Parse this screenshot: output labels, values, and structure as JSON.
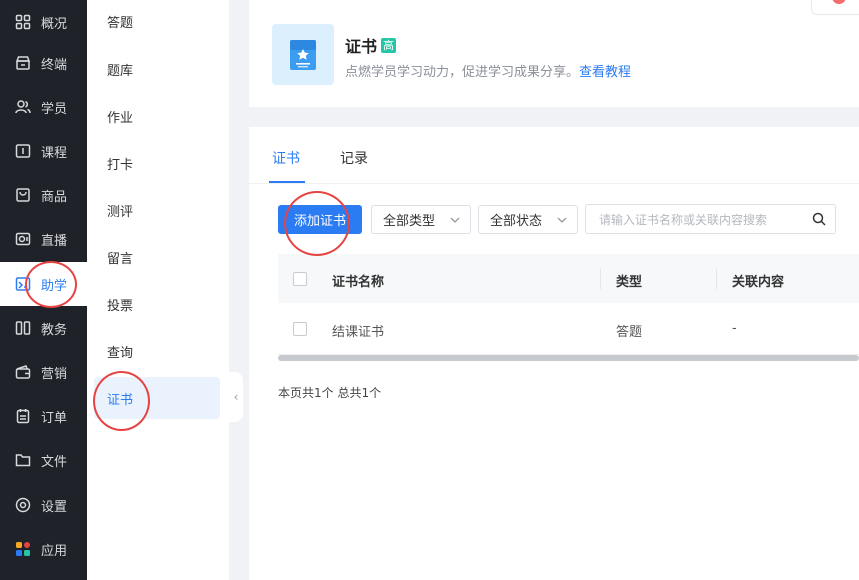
{
  "nav": {
    "items": [
      {
        "label": "概况",
        "icon": "grid-icon"
      },
      {
        "label": "终端",
        "icon": "terminal-icon"
      },
      {
        "label": "学员",
        "icon": "users-icon"
      },
      {
        "label": "课程",
        "icon": "course-icon"
      },
      {
        "label": "商品",
        "icon": "bag-icon"
      },
      {
        "label": "直播",
        "icon": "live-icon"
      },
      {
        "label": "助学",
        "icon": "study-icon"
      },
      {
        "label": "教务",
        "icon": "books-icon"
      },
      {
        "label": "营销",
        "icon": "wallet-icon"
      },
      {
        "label": "订单",
        "icon": "order-icon"
      },
      {
        "label": "文件",
        "icon": "folder-icon"
      },
      {
        "label": "设置",
        "icon": "settings-icon"
      },
      {
        "label": "应用",
        "icon": "apps-icon"
      }
    ],
    "active_index": 6,
    "accent": "#2b7cf3"
  },
  "submenu": {
    "items": [
      "答题",
      "题库",
      "作业",
      "打卡",
      "测评",
      "留言",
      "投票",
      "查询",
      "证书"
    ],
    "active": "证书"
  },
  "header": {
    "title": "证书",
    "badge": "高",
    "description": "点燃学员学习动力，促进学习成果分享。",
    "link": "查看教程"
  },
  "tabs": [
    {
      "label": "证书",
      "active": true
    },
    {
      "label": "记录",
      "active": false
    }
  ],
  "toolbar": {
    "add_button": "添加证书",
    "type_filter": "全部类型",
    "status_filter": "全部状态",
    "search_placeholder": "请输入证书名称或关联内容搜索"
  },
  "table": {
    "columns": [
      "证书名称",
      "类型",
      "关联内容"
    ],
    "rows": [
      {
        "name": "结课证书",
        "type": "答题",
        "related": "-"
      }
    ]
  },
  "footer": {
    "summary": "本页共1个 总共1个"
  },
  "annotation_color": "#e64343"
}
